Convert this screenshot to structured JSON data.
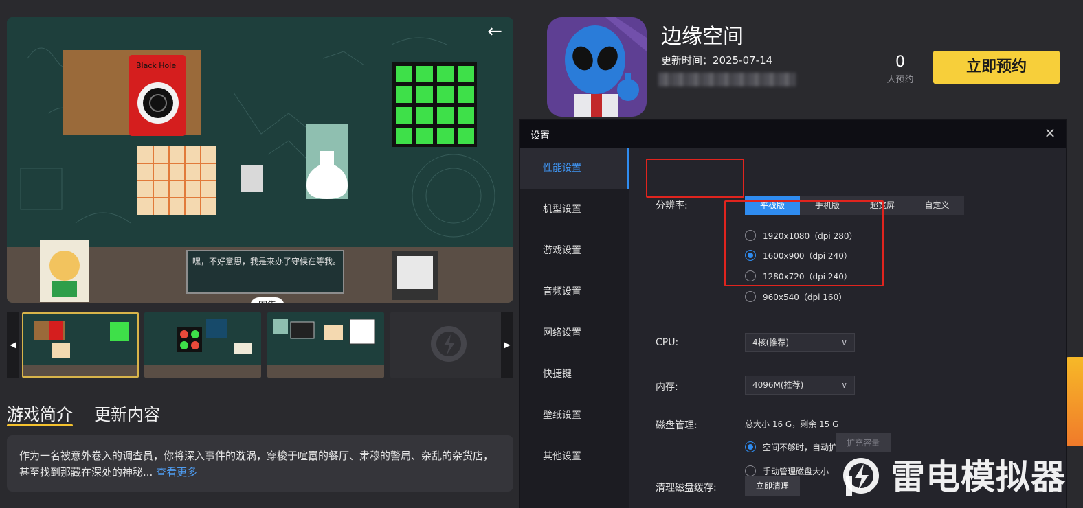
{
  "gallery": {
    "pill_label": "图集",
    "back_icon": "arrow-left-icon",
    "scene_text": "嘿，不好意思，我是来办了守候在等我。",
    "card_text": "Black Hole"
  },
  "intro": {
    "tabs": [
      {
        "label": "游戏简介",
        "active": true
      },
      {
        "label": "更新内容",
        "active": false
      }
    ],
    "text": "作为一名被意外卷入的调查员，你将深入事件的漩涡，穿梭于喧嚣的餐厅、肃穆的警局、杂乱的杂货店，甚至找到那藏在深处的神秘...",
    "more": "查看更多"
  },
  "game": {
    "title": "边缘空间",
    "update_time": "更新时间：2025-07-14",
    "reserve_count": "0",
    "reserve_label": "人预约",
    "reserve_button": "立即预约"
  },
  "settings": {
    "title": "设置",
    "close_icon": "close-icon",
    "nav": [
      {
        "label": "性能设置",
        "active": true
      },
      {
        "label": "机型设置",
        "active": false
      },
      {
        "label": "游戏设置",
        "active": false
      },
      {
        "label": "音频设置",
        "active": false
      },
      {
        "label": "网络设置",
        "active": false
      },
      {
        "label": "快捷键",
        "active": false
      },
      {
        "label": "壁纸设置",
        "active": false
      },
      {
        "label": "其他设置",
        "active": false
      }
    ],
    "resolution": {
      "label": "分辨率:",
      "modes": [
        {
          "label": "平板版",
          "active": true
        },
        {
          "label": "手机版",
          "active": false
        },
        {
          "label": "超宽屏",
          "active": false
        },
        {
          "label": "自定义",
          "active": false
        }
      ],
      "options": [
        {
          "label": "1920x1080（dpi 280）",
          "selected": false
        },
        {
          "label": "1600x900（dpi 240）",
          "selected": true
        },
        {
          "label": "1280x720（dpi 240）",
          "selected": false
        },
        {
          "label": "960x540（dpi 160）",
          "selected": false
        }
      ]
    },
    "cpu": {
      "label": "CPU:",
      "value": "4核(推荐)"
    },
    "memory": {
      "label": "内存:",
      "value": "4096M(推荐)"
    },
    "disk": {
      "label": "磁盘管理:",
      "info": "总大小 16 G，剩余 15 G",
      "options": [
        {
          "label": "空间不够时，自动扩充",
          "selected": true
        },
        {
          "label": "手动管理磁盘大小",
          "selected": false
        }
      ],
      "expand_button": "扩充容量"
    },
    "cache": {
      "label": "清理磁盘缓存:",
      "button": "立即清理"
    }
  },
  "watermark": {
    "text": "雷电模拟器"
  },
  "colors": {
    "accent": "#2f8cf0",
    "reserve": "#f7cf3a",
    "highlight": "#e0241e"
  }
}
